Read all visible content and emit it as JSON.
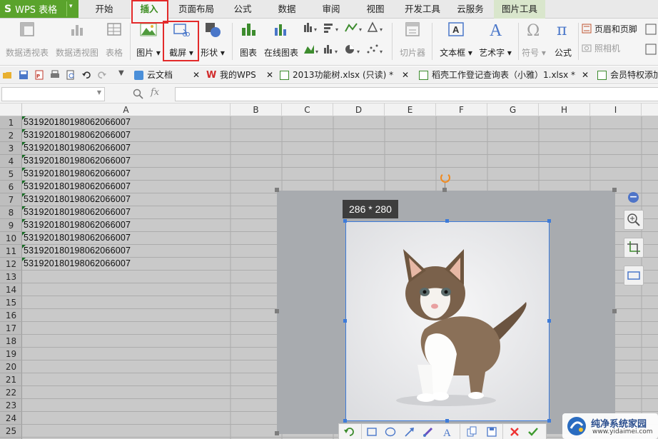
{
  "app": {
    "title": "WPS 表格"
  },
  "ribbon_tabs": [
    {
      "label": "开始"
    },
    {
      "label": "插入"
    },
    {
      "label": "页面布局"
    },
    {
      "label": "公式"
    },
    {
      "label": "数据"
    },
    {
      "label": "审阅"
    },
    {
      "label": "视图"
    },
    {
      "label": "开发工具"
    },
    {
      "label": "云服务"
    },
    {
      "label": "图片工具"
    }
  ],
  "ribbon": {
    "pivot_table": "数据透视表",
    "pivot_chart": "数据透视图",
    "table": "表格",
    "picture": "图片",
    "screenshot": "截屏",
    "shapes": "形状",
    "chart": "图表",
    "online_chart": "在线图表",
    "slicer": "切片器",
    "textbox": "文本框",
    "wordart": "艺术字",
    "symbol": "符号",
    "formula": "公式",
    "header_footer": "页眉和页脚",
    "camera": "照相机"
  },
  "doc_tabs": [
    {
      "label": "云文档"
    },
    {
      "label": "我的WPS"
    },
    {
      "label": "2013功能树.xlsx (只读) *"
    },
    {
      "label": "稻壳工作登记查询表（小雅）1.xlsx *"
    },
    {
      "label": "会员特权添加"
    }
  ],
  "formula_bar": {
    "fx": "fx",
    "value": ""
  },
  "columns": [
    "A",
    "B",
    "C",
    "D",
    "E",
    "F",
    "G",
    "H",
    "I"
  ],
  "rows": [
    "1",
    "2",
    "3",
    "4",
    "5",
    "6",
    "7",
    "8",
    "9",
    "10",
    "11",
    "12",
    "13",
    "14",
    "15",
    "16",
    "17",
    "18",
    "19",
    "20",
    "21",
    "22",
    "23",
    "24",
    "25"
  ],
  "cells_A": [
    "531920180198062066007",
    "531920180198062066007",
    "531920180198062066007",
    "531920180198062066007",
    "531920180198062066007",
    "531920180198062066007",
    "531920180198062066007",
    "531920180198062066007",
    "531920180198062066007",
    "531920180198062066007",
    "531920180198062066007",
    "531920180198062066007"
  ],
  "capture": {
    "size_label": "286 * 280"
  },
  "watermark": {
    "title": "纯净系统家园",
    "url": "www.yidaimei.com"
  },
  "colors": {
    "wps_green": "#5aa32c",
    "highlight_red": "#e32a2a",
    "selection_blue": "#3d7bd9"
  }
}
